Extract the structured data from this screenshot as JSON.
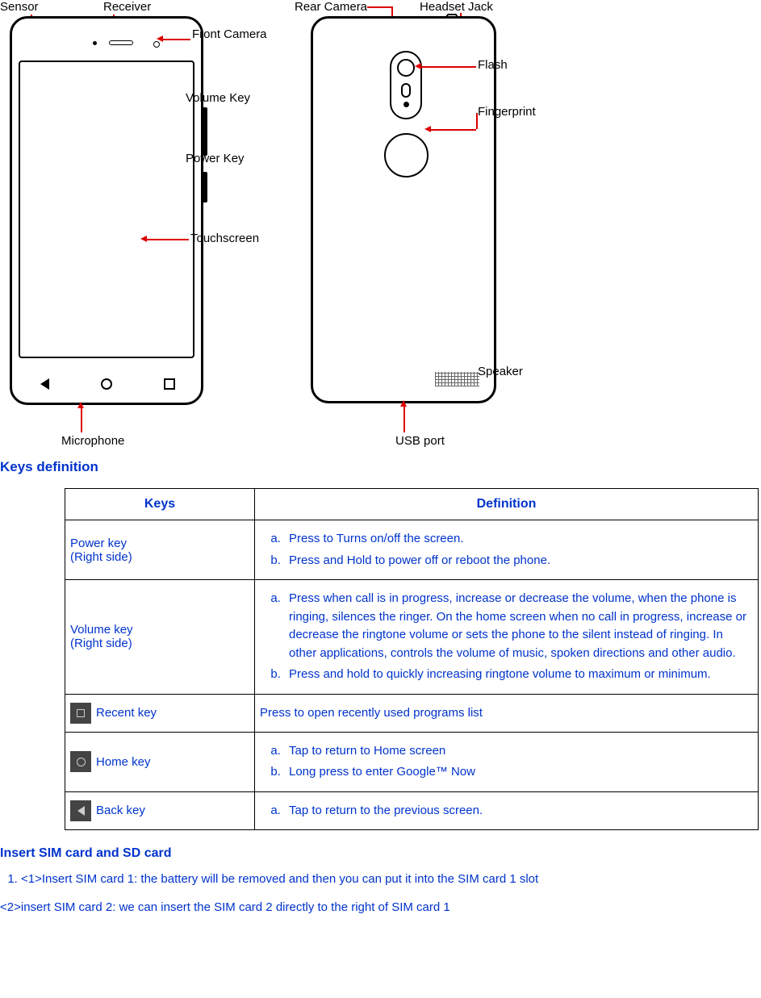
{
  "diagram": {
    "front": {
      "sensor": "Sensor",
      "receiver": "Receiver",
      "front_camera": "Front Camera",
      "volume_key": "Volume Key",
      "power_key": "Power Key",
      "touchscreen": "Touchscreen",
      "microphone": "Microphone"
    },
    "back": {
      "rear_camera": "Rear Camera",
      "headset_jack": "Headset Jack",
      "flash": "Flash",
      "fingerprint": "Fingerprint",
      "speaker": "Speaker",
      "usb_port": "USB port"
    }
  },
  "keys_heading": "Keys definition",
  "table": {
    "header_keys": "Keys",
    "header_def": "Definition",
    "rows": [
      {
        "name": "Power key",
        "sub": "(Right side)",
        "defs": [
          "Press to Turns on/off the screen.",
          "Press and Hold to power off or reboot the phone."
        ]
      },
      {
        "name": "Volume key",
        "sub": "(Right side)",
        "defs": [
          "Press when call is in progress, increase or decrease the volume, when the phone is ringing, silences the ringer. On the home screen when no call in progress, increase or decrease the ringtone volume or sets the phone to the silent instead of ringing. In other applications, controls the volume of music, spoken directions and other audio.",
          "Press and hold to quickly increasing ringtone volume to maximum or minimum."
        ]
      },
      {
        "name": "Recent key",
        "icon": "square",
        "plain": "Press to open recently used programs list"
      },
      {
        "name": "Home key",
        "icon": "circle",
        "defs": [
          "Tap to return to Home screen",
          "Long press to enter Google™ Now"
        ]
      },
      {
        "name": "Back key",
        "icon": "triangle",
        "defs": [
          "Tap to return to the previous screen."
        ]
      }
    ]
  },
  "sim": {
    "heading": "Insert SIM card and SD card",
    "item1_num": "1.",
    "item1": "<1>Insert SIM card 1: the battery will be removed and then you can put it into the SIM card 1 slot",
    "item2": "<2>insert SIM card 2: we can insert the SIM card 2 directly to the right of SIM card 1"
  }
}
